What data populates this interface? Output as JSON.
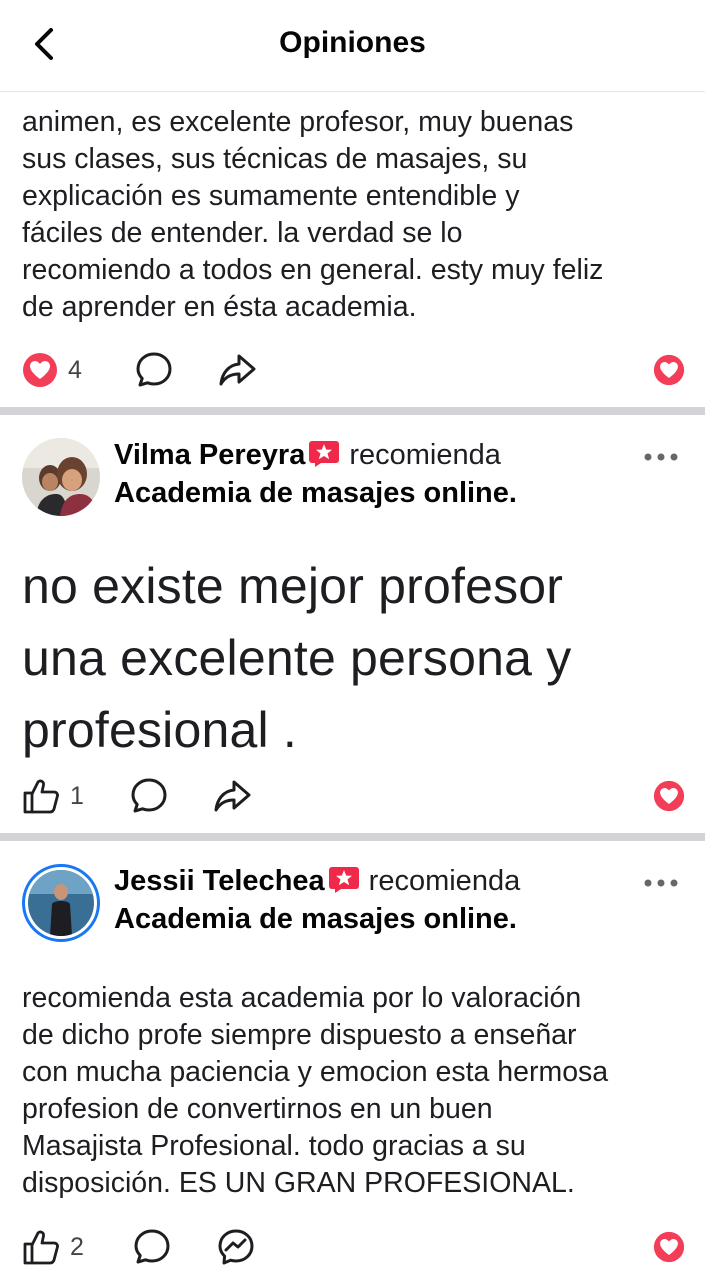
{
  "header": {
    "title": "Opiniones"
  },
  "post1": {
    "text_lines": [
      "animen, es excelente profesor, muy buenas",
      "sus clases, sus técnicas de masajes, su",
      "explicación es sumamente entendible y",
      "fáciles de entender. la verdad se lo",
      "recomiendo a todos en general. esty muy feliz",
      "de aprender  en ésta academia."
    ],
    "reaction_count": "4"
  },
  "post2": {
    "author": "Vilma Pereyra",
    "recommends": "recomienda",
    "page": "Academia de masajes online.",
    "text_lines": [
      "no existe mejor profesor",
      "una excelente persona y",
      "profesional ."
    ],
    "like_count": "1"
  },
  "post3": {
    "author": "Jessii Telechea",
    "recommends": "recomienda",
    "page": "Academia de masajes online.",
    "text_lines": [
      "recomienda esta academia por lo valoración",
      "de dicho profe siempre dispuesto a enseñar",
      "con mucha paciencia y emocion esta hermosa",
      "profesion de convertirnos en un buen",
      "Masajista Profesional. todo gracias a su",
      "disposición. ES UN GRAN PROFESIONAL."
    ],
    "like_count": "2"
  },
  "icons": {
    "back": "chevron-left-icon",
    "love": "heart-reaction-icon",
    "comment": "comment-bubble-icon",
    "share": "share-arrow-icon",
    "like": "thumbs-up-icon",
    "messenger": "messenger-icon",
    "recommend": "recommendation-star-icon",
    "more": "more-dots-icon"
  },
  "colors": {
    "love_red": "#f33e58",
    "recommend_red": "#f02849",
    "avatar_ring_blue": "#1877f2",
    "divider": "#d2d4d8"
  }
}
